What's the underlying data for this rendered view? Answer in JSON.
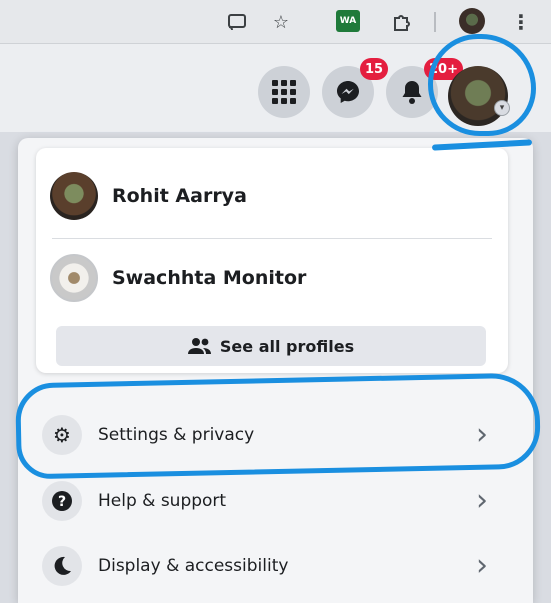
{
  "browser_toolbar": {
    "icons": [
      "cast-icon",
      "star-icon",
      "extension-wa-icon",
      "puzzle-icon",
      "profile-avatar",
      "more-vert-icon"
    ],
    "extension_label": "WA"
  },
  "header": {
    "menu_button_icon": "grid-icon",
    "messenger": {
      "icon": "messenger-icon",
      "badge": "15"
    },
    "notifications": {
      "icon": "bell-icon",
      "badge": "20+"
    },
    "profile_button": {
      "icon": "avatar"
    }
  },
  "account_menu": {
    "profiles": [
      {
        "name": "Rohit Aarrya"
      },
      {
        "name": "Swachhta Monitor"
      }
    ],
    "see_all_label": "See all profiles",
    "items": [
      {
        "label": "Settings & privacy",
        "icon": "gear-icon"
      },
      {
        "label": "Help & support",
        "icon": "help-icon"
      },
      {
        "label": "Display & accessibility",
        "icon": "moon-icon"
      }
    ]
  },
  "colors": {
    "annotation_blue": "#1a8fe0",
    "badge_red": "#e41e3f"
  }
}
